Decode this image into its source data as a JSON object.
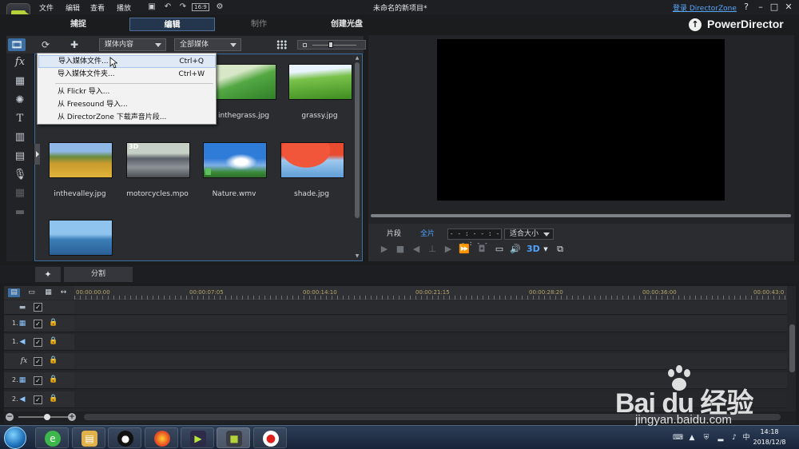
{
  "menu": {
    "file": "文件",
    "edit": "编辑",
    "view": "查看",
    "play": "播放"
  },
  "toolbar": {
    "bitrate_label": "16:9"
  },
  "window": {
    "title": "未命名的新项目*",
    "login_link": "登录 DirectorZone",
    "help": "?",
    "minimize": "–",
    "restore": "□",
    "close": "✕"
  },
  "modes": {
    "capture": "捕捉",
    "edit": "编辑",
    "produce": "制作",
    "disc": "创建光盘"
  },
  "brand": {
    "name": "PowerDirector"
  },
  "library": {
    "content_dropdown": "媒体内容",
    "filter_dropdown": "全部媒体",
    "items": [
      {
        "name": "inthegrass.jpg",
        "badge": ""
      },
      {
        "name": "grassy.jpg",
        "badge": ""
      },
      {
        "name": "inthevalley.jpg",
        "badge": ""
      },
      {
        "name": "motorcycles.mpo",
        "badge": "3D"
      },
      {
        "name": "Nature.wmv",
        "badge": ""
      },
      {
        "name": "shade.jpg",
        "badge": ""
      }
    ]
  },
  "context_menu": {
    "items": [
      {
        "label": "导入媒体文件...",
        "shortcut": "Ctrl+Q"
      },
      {
        "label": "导入媒体文件夹...",
        "shortcut": "Ctrl+W"
      },
      {
        "label": "从 Flickr 导入...",
        "shortcut": ""
      },
      {
        "label": "从 Freesound 导入...",
        "shortcut": ""
      },
      {
        "label": "从 DirectorZone 下载声音片段...",
        "shortcut": ""
      }
    ]
  },
  "preview": {
    "clip_tab": "片段",
    "movie_tab": "全片",
    "timecode": "- - : - - : - - : - -",
    "fit_select": "适合大小",
    "mode_3d": "3D"
  },
  "split_bar": {
    "split_label": "分割"
  },
  "timeline": {
    "ruler_labels": [
      "00:00:00:00",
      "00:00:07:05",
      "00:00:14:10",
      "00:00:21:15",
      "00:00:28:20",
      "00:00:36:00",
      "00:00:43:0"
    ],
    "tracks": [
      {
        "num": "",
        "type": "video"
      },
      {
        "num": "1.",
        "type": "video"
      },
      {
        "num": "1.",
        "type": "audio"
      },
      {
        "num": "",
        "type": "fx"
      },
      {
        "num": "2.",
        "type": "video"
      },
      {
        "num": "2.",
        "type": "audio"
      }
    ],
    "check_mark": "✓",
    "fx_label": "fx"
  },
  "taskbar": {
    "time": "14:18",
    "date": "2018/12/8"
  },
  "watermark": {
    "text": "Bai du 经验",
    "url": "jingyan.baidu.com"
  },
  "colors": {
    "accent": "#3b6fa3",
    "link": "#5aa9ff",
    "three_d": "#4fa3ff"
  }
}
